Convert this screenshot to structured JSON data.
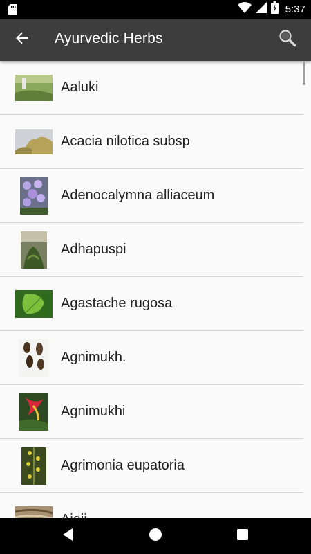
{
  "status_bar": {
    "time": "5:37",
    "icons": [
      "sd-card-icon",
      "wifi-icon",
      "signal-icon",
      "battery-charging-icon"
    ]
  },
  "app_bar": {
    "title": "Ayurvedic Herbs",
    "back_icon": "arrow-back-icon",
    "search_icon": "search-icon"
  },
  "herbs": [
    {
      "name": "Aaluki"
    },
    {
      "name": "Acacia nilotica subsp"
    },
    {
      "name": "Adenocalymna alliaceum"
    },
    {
      "name": "Adhapuspi"
    },
    {
      "name": "Agastache rugosa"
    },
    {
      "name": "Agnimukh."
    },
    {
      "name": "Agnimukhi"
    },
    {
      "name": "Agrimonia eupatoria"
    },
    {
      "name": "Ajaji"
    }
  ],
  "nav_bar": {
    "icons": [
      "back-triangle-icon",
      "home-circle-icon",
      "recents-square-icon"
    ]
  },
  "colors": {
    "app_bar": "#3d3d3d",
    "background": "#fafafa",
    "divider": "#d4d4d4",
    "text": "#212121"
  }
}
